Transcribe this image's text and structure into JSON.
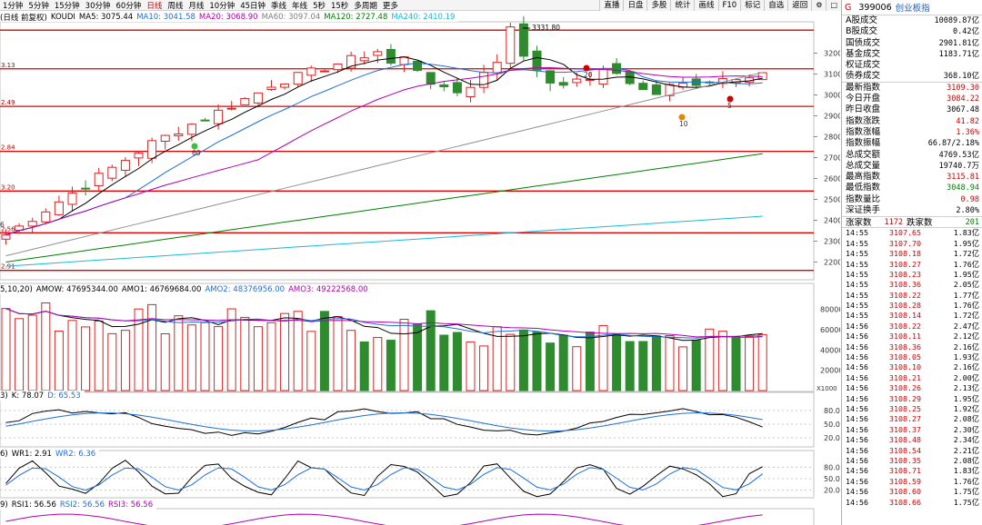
{
  "toolbar": {
    "periods": [
      "1分钟",
      "5分钟",
      "15分钟",
      "30分钟",
      "60分钟",
      "日线",
      "周线",
      "月线",
      "10分钟",
      "45日钟",
      "季线",
      "年线",
      "5秒",
      "15秒",
      "多周期",
      "更多"
    ],
    "active_period": "日线",
    "right_buttons": [
      "直播",
      "日盘",
      "多股",
      "统计",
      "画线",
      "F10",
      "标记",
      "自选",
      "返回"
    ]
  },
  "main_legend": {
    "prefix": "(日线 前复权)",
    "indicator": "KOUDI",
    "ma": [
      {
        "label": "MA5: 3075.44",
        "color": "#000000"
      },
      {
        "label": "MA10: 3041.58",
        "color": "#1e6fd6"
      },
      {
        "label": "MA20: 3068.90",
        "color": "#b000b0"
      },
      {
        "label": "MA60: 3097.04",
        "color": "#808080"
      },
      {
        "label": "MA120: 2727.48",
        "color": "#008000"
      },
      {
        "label": "MA240: 2410.19",
        "color": "#1cb8d8"
      }
    ]
  },
  "price_axis": [
    "3200",
    "3100",
    "3000",
    "2900",
    "2800",
    "2700",
    "2600",
    "2500",
    "2400",
    "2300",
    "2200"
  ],
  "level_labels": [
    "3.13",
    "2.49",
    "2.84",
    "3.20",
    "2.56",
    "2.91"
  ],
  "annotations": {
    "high": "3331.80",
    "markers": [
      "60",
      "20",
      "10",
      "5",
      "6"
    ]
  },
  "volume_legend": {
    "prefix": "5,10,20)",
    "items": [
      {
        "label": "AMOW: 47695344.00",
        "color": "#000000"
      },
      {
        "label": "AMO1: 46769684.00",
        "color": "#000000"
      },
      {
        "label": "AMO2: 48376956.00",
        "color": "#1e6fd6"
      },
      {
        "label": "AMO3: 49222568.00",
        "color": "#b000b0"
      }
    ]
  },
  "volume_axis": [
    "80000",
    "60000",
    "40000",
    "20000"
  ],
  "volume_unit": "X1000",
  "kdj_legend": {
    "prefix": "3)",
    "items": [
      {
        "label": "K: 78.07",
        "color": "#000000"
      },
      {
        "label": "D: 65.53",
        "color": "#1e6fd6"
      }
    ]
  },
  "kdj_axis": [
    "80.00",
    "50.00",
    "20.00"
  ],
  "wr_legend": {
    "prefix": "6)",
    "items": [
      {
        "label": "WR1: 2.91",
        "color": "#000000"
      },
      {
        "label": "WR2: 6.36",
        "color": "#1e6fd6"
      }
    ]
  },
  "wr_axis": [
    "80.00",
    "50.00",
    "20.00"
  ],
  "rsi_legend": {
    "prefix": "9)",
    "items": [
      {
        "label": "RSI1: 56.56",
        "color": "#000000"
      },
      {
        "label": "RSI2: 56.56",
        "color": "#1e6fd6"
      },
      {
        "label": "RSI3: 56.56",
        "color": "#b000b0"
      }
    ]
  },
  "info": {
    "g": "G",
    "code": "399006",
    "name": "创业板指",
    "rows": [
      {
        "label": "A股成交",
        "value": "10089.87亿",
        "color": "blk"
      },
      {
        "label": "B股成交",
        "value": "0.42亿",
        "color": "blk"
      },
      {
        "label": "国债成交",
        "value": "2901.81亿",
        "color": "blk"
      },
      {
        "label": "基金成交",
        "value": "1183.71亿",
        "color": "blk"
      },
      {
        "label": "权证成交",
        "value": "",
        "color": "blk"
      },
      {
        "label": "债券成交",
        "value": "368.10亿",
        "color": "blk"
      },
      {
        "label": "最新指数",
        "value": "3109.30",
        "color": "red"
      },
      {
        "label": "今日开盘",
        "value": "3084.22",
        "color": "red"
      },
      {
        "label": "昨日收盘",
        "value": "3067.48",
        "color": "blk"
      },
      {
        "label": "指数涨跌",
        "value": "41.82",
        "color": "red"
      },
      {
        "label": "指数涨幅",
        "value": "1.36%",
        "color": "red"
      },
      {
        "label": "指数振幅",
        "value": "66.87/2.18%",
        "color": "blk"
      },
      {
        "label": "总成交额",
        "value": "4769.53亿",
        "color": "blk"
      },
      {
        "label": "总成交量",
        "value": "19740.7万",
        "color": "blk"
      },
      {
        "label": "最高指数",
        "value": "3115.81",
        "color": "red"
      },
      {
        "label": "最低指数",
        "value": "3048.94",
        "color": "green"
      },
      {
        "label": "指数量比",
        "value": "0.98",
        "color": "red"
      },
      {
        "label": "深证换手",
        "value": "2.80%",
        "color": "blk"
      }
    ],
    "up_label": "涨家数",
    "up_count": "1172",
    "down_label": "跌家数",
    "down_count": "201",
    "ticks": [
      {
        "time": "14:55",
        "price": "3107.65",
        "amount": "1.83亿"
      },
      {
        "time": "14:55",
        "price": "3107.70",
        "amount": "1.95亿"
      },
      {
        "time": "14:55",
        "price": "3108.18",
        "amount": "1.72亿"
      },
      {
        "time": "14:55",
        "price": "3108.27",
        "amount": "1.76亿"
      },
      {
        "time": "14:55",
        "price": "3108.23",
        "amount": "1.95亿"
      },
      {
        "time": "14:55",
        "price": "3108.36",
        "amount": "2.05亿"
      },
      {
        "time": "14:55",
        "price": "3108.22",
        "amount": "1.77亿"
      },
      {
        "time": "14:55",
        "price": "3108.28",
        "amount": "1.76亿"
      },
      {
        "time": "14:55",
        "price": "3108.14",
        "amount": "1.72亿"
      },
      {
        "time": "14:56",
        "price": "3108.22",
        "amount": "2.47亿"
      },
      {
        "time": "14:56",
        "price": "3108.11",
        "amount": "2.12亿"
      },
      {
        "time": "14:56",
        "price": "3108.36",
        "amount": "2.16亿"
      },
      {
        "time": "14:56",
        "price": "3108.05",
        "amount": "1.93亿"
      },
      {
        "time": "14:56",
        "price": "3108.10",
        "amount": "2.16亿"
      },
      {
        "time": "14:56",
        "price": "3108.21",
        "amount": "2.00亿"
      },
      {
        "time": "14:56",
        "price": "3108.26",
        "amount": "2.13亿"
      },
      {
        "time": "14:56",
        "price": "3108.29",
        "amount": "1.95亿"
      },
      {
        "time": "14:56",
        "price": "3108.25",
        "amount": "1.92亿"
      },
      {
        "time": "14:56",
        "price": "3108.27",
        "amount": "2.08亿"
      },
      {
        "time": "14:56",
        "price": "3108.37",
        "amount": "2.30亿"
      },
      {
        "time": "14:56",
        "price": "3108.48",
        "amount": "2.34亿"
      },
      {
        "time": "14:56",
        "price": "3108.54",
        "amount": "2.21亿"
      },
      {
        "time": "14:56",
        "price": "3108.35",
        "amount": "2.08亿"
      },
      {
        "time": "14:56",
        "price": "3108.71",
        "amount": "1.83亿"
      },
      {
        "time": "14:56",
        "price": "3108.59",
        "amount": "1.76亿"
      },
      {
        "time": "14:56",
        "price": "3108.60",
        "amount": "1.75亿"
      },
      {
        "time": "14:56",
        "price": "3108.66",
        "amount": "1.75亿"
      }
    ]
  },
  "colors": {
    "up": "#e02020",
    "down": "#2e8b2e",
    "level_line": "#e00000",
    "panel_border": "#c0c0c0"
  }
}
